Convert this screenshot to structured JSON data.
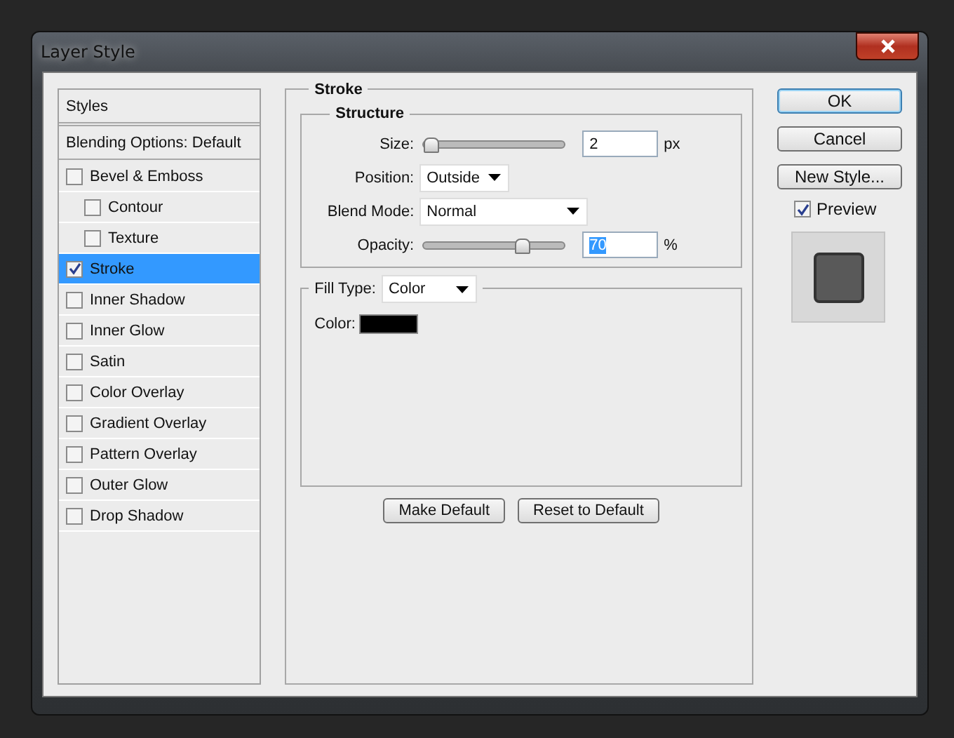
{
  "window": {
    "title": "Layer Style"
  },
  "sidebar": {
    "header": "Styles",
    "blending": "Blending Options: Default",
    "items": [
      {
        "label": "Bevel & Emboss",
        "checked": false,
        "selected": false,
        "children": [
          {
            "label": "Contour",
            "checked": false,
            "selected": false
          },
          {
            "label": "Texture",
            "checked": false,
            "selected": false
          }
        ]
      },
      {
        "label": "Stroke",
        "checked": true,
        "selected": true
      },
      {
        "label": "Inner Shadow",
        "checked": false,
        "selected": false
      },
      {
        "label": "Inner Glow",
        "checked": false,
        "selected": false
      },
      {
        "label": "Satin",
        "checked": false,
        "selected": false
      },
      {
        "label": "Color Overlay",
        "checked": false,
        "selected": false
      },
      {
        "label": "Gradient Overlay",
        "checked": false,
        "selected": false
      },
      {
        "label": "Pattern Overlay",
        "checked": false,
        "selected": false
      },
      {
        "label": "Outer Glow",
        "checked": false,
        "selected": false
      },
      {
        "label": "Drop Shadow",
        "checked": false,
        "selected": false
      }
    ]
  },
  "stroke": {
    "title": "Stroke",
    "structure": {
      "title": "Structure",
      "size": {
        "label": "Size:",
        "level": 0.0,
        "value": "2",
        "unit": "px"
      },
      "position": {
        "label": "Position:",
        "value": "Outside"
      },
      "blend_mode": {
        "label": "Blend Mode:",
        "value": "Normal"
      },
      "opacity": {
        "label": "Opacity:",
        "level": 0.7,
        "value": "70",
        "unit": "%",
        "value_selected": true
      }
    },
    "fill_type": {
      "label": "Fill Type:",
      "value": "Color"
    },
    "color": {
      "label": "Color:",
      "color": "#000000"
    },
    "buttons": [
      "Make Default",
      "Reset to Default"
    ]
  },
  "actions": [
    {
      "label": "OK",
      "default": true
    },
    {
      "label": "Cancel",
      "default": false
    },
    {
      "label": "New Style...",
      "default": false
    }
  ],
  "preview": {
    "label": "Preview",
    "checked": true
  }
}
